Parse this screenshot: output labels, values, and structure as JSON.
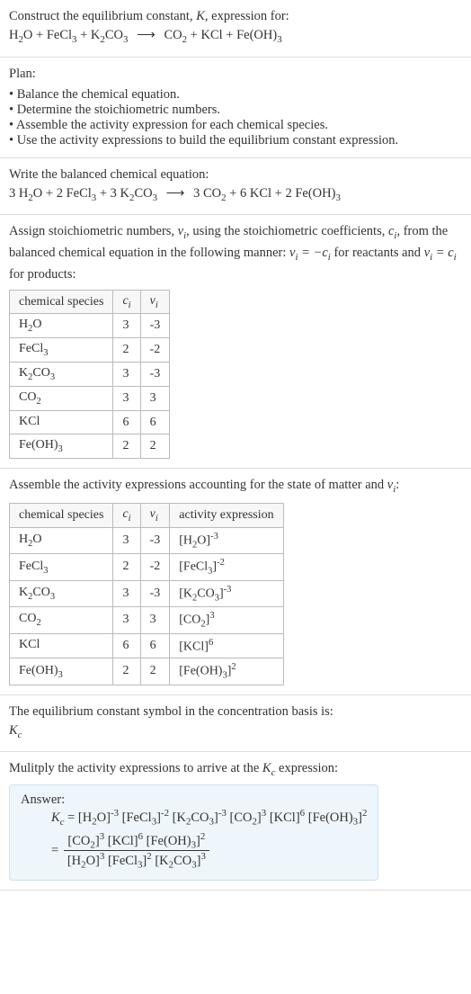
{
  "intro": {
    "line1_a": "Construct the equilibrium constant, ",
    "K": "K",
    "line1_b": ", expression for:",
    "eqn_lhs": [
      "H",
      "2",
      "O + FeCl",
      "3",
      " + K",
      "2",
      "CO",
      "3"
    ],
    "arrow": "⟶",
    "eqn_rhs": [
      "CO",
      "2",
      " + KCl + Fe(OH)",
      "3"
    ]
  },
  "plan": {
    "title": "Plan:",
    "items": [
      "Balance the chemical equation.",
      "Determine the stoichiometric numbers.",
      "Assemble the activity expression for each chemical species.",
      "Use the activity expressions to build the equilibrium constant expression."
    ]
  },
  "balanced": {
    "title": "Write the balanced chemical equation:",
    "lhs": [
      "3 H",
      "2",
      "O + 2 FeCl",
      "3",
      " + 3 K",
      "2",
      "CO",
      "3"
    ],
    "arrow": "⟶",
    "rhs": [
      "3 CO",
      "2",
      " + 6 KCl + 2 Fe(OH)",
      "3"
    ]
  },
  "stoich": {
    "para_a": "Assign stoichiometric numbers, ",
    "nu": "ν",
    "para_b": ", using the stoichiometric coefficients, ",
    "ci": "c",
    "para_c": ", from the balanced chemical equation in the following manner: ",
    "rel1": "ν_i = -c_i",
    "para_d": " for reactants and ",
    "rel2": "ν_i = c_i",
    "para_e": " for products:",
    "headers": [
      "chemical species",
      "c_i",
      "ν_i"
    ],
    "rows": [
      {
        "sp": [
          "H",
          "2",
          "O"
        ],
        "c": "3",
        "nu": "-3"
      },
      {
        "sp": [
          "FeCl",
          "3",
          ""
        ],
        "c": "2",
        "nu": "-2"
      },
      {
        "sp": [
          "K",
          "2",
          "CO",
          "3"
        ],
        "c": "3",
        "nu": "-3"
      },
      {
        "sp": [
          "CO",
          "2",
          ""
        ],
        "c": "3",
        "nu": "3"
      },
      {
        "sp": [
          "KCl",
          "",
          ""
        ],
        "c": "6",
        "nu": "6"
      },
      {
        "sp": [
          "Fe(OH)",
          "3",
          ""
        ],
        "c": "2",
        "nu": "2"
      }
    ]
  },
  "activity": {
    "title_a": "Assemble the activity expressions accounting for the state of matter and ",
    "nu": "ν",
    "title_b": ":",
    "headers": [
      "chemical species",
      "c_i",
      "ν_i",
      "activity expression"
    ],
    "rows": [
      {
        "sp": [
          "H",
          "2",
          "O"
        ],
        "c": "3",
        "nu": "-3",
        "act_base": "[H2O]",
        "act_exp": "-3"
      },
      {
        "sp": [
          "FeCl",
          "3",
          ""
        ],
        "c": "2",
        "nu": "-2",
        "act_base": "[FeCl3]",
        "act_exp": "-2"
      },
      {
        "sp": [
          "K",
          "2",
          "CO",
          "3"
        ],
        "c": "3",
        "nu": "-3",
        "act_base": "[K2CO3]",
        "act_exp": "-3"
      },
      {
        "sp": [
          "CO",
          "2",
          ""
        ],
        "c": "3",
        "nu": "3",
        "act_base": "[CO2]",
        "act_exp": "3"
      },
      {
        "sp": [
          "KCl",
          "",
          ""
        ],
        "c": "6",
        "nu": "6",
        "act_base": "[KCl]",
        "act_exp": "6"
      },
      {
        "sp": [
          "Fe(OH)",
          "3",
          ""
        ],
        "c": "2",
        "nu": "2",
        "act_base": "[Fe(OH)3]",
        "act_exp": "2"
      }
    ]
  },
  "basis": {
    "line1": "The equilibrium constant symbol in the concentration basis is:",
    "Kc": "K_c"
  },
  "final": {
    "title": "Mulitply the activity expressions to arrive at the ",
    "Kc": "K_c",
    "title_b": " expression:",
    "answer_label": "Answer:",
    "line1_lhs": "K_c = ",
    "line1_terms": [
      {
        "b": "[H2O]",
        "e": "-3"
      },
      {
        "b": "[FeCl3]",
        "e": "-2"
      },
      {
        "b": "[K2CO3]",
        "e": "-3"
      },
      {
        "b": "[CO2]",
        "e": "3"
      },
      {
        "b": "[KCl]",
        "e": "6"
      },
      {
        "b": "[Fe(OH)3]",
        "e": "2"
      }
    ],
    "frac_num": [
      {
        "b": "[CO2]",
        "e": "3"
      },
      {
        "b": "[KCl]",
        "e": "6"
      },
      {
        "b": "[Fe(OH)3]",
        "e": "2"
      }
    ],
    "frac_den": [
      {
        "b": "[H2O]",
        "e": "3"
      },
      {
        "b": "[FeCl3]",
        "e": "2"
      },
      {
        "b": "[K2CO3]",
        "e": "3"
      }
    ]
  },
  "chart_data": {
    "type": "table",
    "tables": [
      {
        "title": "Stoichiometric numbers",
        "columns": [
          "chemical species",
          "c_i",
          "ν_i"
        ],
        "rows": [
          [
            "H2O",
            3,
            -3
          ],
          [
            "FeCl3",
            2,
            -2
          ],
          [
            "K2CO3",
            3,
            -3
          ],
          [
            "CO2",
            3,
            3
          ],
          [
            "KCl",
            6,
            6
          ],
          [
            "Fe(OH)3",
            2,
            2
          ]
        ]
      },
      {
        "title": "Activity expressions",
        "columns": [
          "chemical species",
          "c_i",
          "ν_i",
          "activity expression"
        ],
        "rows": [
          [
            "H2O",
            3,
            -3,
            "[H2O]^-3"
          ],
          [
            "FeCl3",
            2,
            -2,
            "[FeCl3]^-2"
          ],
          [
            "K2CO3",
            3,
            -3,
            "[K2CO3]^-3"
          ],
          [
            "CO2",
            3,
            3,
            "[CO2]^3"
          ],
          [
            "KCl",
            6,
            6,
            "[KCl]^6"
          ],
          [
            "Fe(OH)3",
            2,
            2,
            "[Fe(OH)3]^2"
          ]
        ]
      }
    ]
  }
}
